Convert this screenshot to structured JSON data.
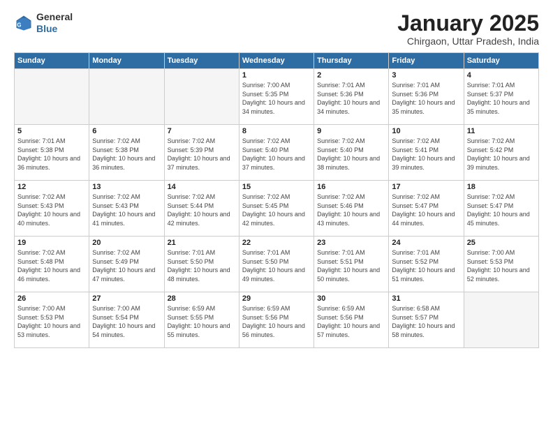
{
  "header": {
    "logo_general": "General",
    "logo_blue": "Blue",
    "title": "January 2025",
    "subtitle": "Chirgaon, Uttar Pradesh, India"
  },
  "weekdays": [
    "Sunday",
    "Monday",
    "Tuesday",
    "Wednesday",
    "Thursday",
    "Friday",
    "Saturday"
  ],
  "weeks": [
    [
      {
        "day": "",
        "empty": true
      },
      {
        "day": "",
        "empty": true
      },
      {
        "day": "",
        "empty": true
      },
      {
        "day": "1",
        "sunrise": "7:00 AM",
        "sunset": "5:35 PM",
        "daylight": "10 hours and 34 minutes."
      },
      {
        "day": "2",
        "sunrise": "7:01 AM",
        "sunset": "5:36 PM",
        "daylight": "10 hours and 34 minutes."
      },
      {
        "day": "3",
        "sunrise": "7:01 AM",
        "sunset": "5:36 PM",
        "daylight": "10 hours and 35 minutes."
      },
      {
        "day": "4",
        "sunrise": "7:01 AM",
        "sunset": "5:37 PM",
        "daylight": "10 hours and 35 minutes."
      }
    ],
    [
      {
        "day": "5",
        "sunrise": "7:01 AM",
        "sunset": "5:38 PM",
        "daylight": "10 hours and 36 minutes."
      },
      {
        "day": "6",
        "sunrise": "7:02 AM",
        "sunset": "5:38 PM",
        "daylight": "10 hours and 36 minutes."
      },
      {
        "day": "7",
        "sunrise": "7:02 AM",
        "sunset": "5:39 PM",
        "daylight": "10 hours and 37 minutes."
      },
      {
        "day": "8",
        "sunrise": "7:02 AM",
        "sunset": "5:40 PM",
        "daylight": "10 hours and 37 minutes."
      },
      {
        "day": "9",
        "sunrise": "7:02 AM",
        "sunset": "5:40 PM",
        "daylight": "10 hours and 38 minutes."
      },
      {
        "day": "10",
        "sunrise": "7:02 AM",
        "sunset": "5:41 PM",
        "daylight": "10 hours and 39 minutes."
      },
      {
        "day": "11",
        "sunrise": "7:02 AM",
        "sunset": "5:42 PM",
        "daylight": "10 hours and 39 minutes."
      }
    ],
    [
      {
        "day": "12",
        "sunrise": "7:02 AM",
        "sunset": "5:43 PM",
        "daylight": "10 hours and 40 minutes."
      },
      {
        "day": "13",
        "sunrise": "7:02 AM",
        "sunset": "5:43 PM",
        "daylight": "10 hours and 41 minutes."
      },
      {
        "day": "14",
        "sunrise": "7:02 AM",
        "sunset": "5:44 PM",
        "daylight": "10 hours and 42 minutes."
      },
      {
        "day": "15",
        "sunrise": "7:02 AM",
        "sunset": "5:45 PM",
        "daylight": "10 hours and 42 minutes."
      },
      {
        "day": "16",
        "sunrise": "7:02 AM",
        "sunset": "5:46 PM",
        "daylight": "10 hours and 43 minutes."
      },
      {
        "day": "17",
        "sunrise": "7:02 AM",
        "sunset": "5:47 PM",
        "daylight": "10 hours and 44 minutes."
      },
      {
        "day": "18",
        "sunrise": "7:02 AM",
        "sunset": "5:47 PM",
        "daylight": "10 hours and 45 minutes."
      }
    ],
    [
      {
        "day": "19",
        "sunrise": "7:02 AM",
        "sunset": "5:48 PM",
        "daylight": "10 hours and 46 minutes."
      },
      {
        "day": "20",
        "sunrise": "7:02 AM",
        "sunset": "5:49 PM",
        "daylight": "10 hours and 47 minutes."
      },
      {
        "day": "21",
        "sunrise": "7:01 AM",
        "sunset": "5:50 PM",
        "daylight": "10 hours and 48 minutes."
      },
      {
        "day": "22",
        "sunrise": "7:01 AM",
        "sunset": "5:50 PM",
        "daylight": "10 hours and 49 minutes."
      },
      {
        "day": "23",
        "sunrise": "7:01 AM",
        "sunset": "5:51 PM",
        "daylight": "10 hours and 50 minutes."
      },
      {
        "day": "24",
        "sunrise": "7:01 AM",
        "sunset": "5:52 PM",
        "daylight": "10 hours and 51 minutes."
      },
      {
        "day": "25",
        "sunrise": "7:00 AM",
        "sunset": "5:53 PM",
        "daylight": "10 hours and 52 minutes."
      }
    ],
    [
      {
        "day": "26",
        "sunrise": "7:00 AM",
        "sunset": "5:53 PM",
        "daylight": "10 hours and 53 minutes."
      },
      {
        "day": "27",
        "sunrise": "7:00 AM",
        "sunset": "5:54 PM",
        "daylight": "10 hours and 54 minutes."
      },
      {
        "day": "28",
        "sunrise": "6:59 AM",
        "sunset": "5:55 PM",
        "daylight": "10 hours and 55 minutes."
      },
      {
        "day": "29",
        "sunrise": "6:59 AM",
        "sunset": "5:56 PM",
        "daylight": "10 hours and 56 minutes."
      },
      {
        "day": "30",
        "sunrise": "6:59 AM",
        "sunset": "5:56 PM",
        "daylight": "10 hours and 57 minutes."
      },
      {
        "day": "31",
        "sunrise": "6:58 AM",
        "sunset": "5:57 PM",
        "daylight": "10 hours and 58 minutes."
      },
      {
        "day": "",
        "empty": true
      }
    ]
  ]
}
